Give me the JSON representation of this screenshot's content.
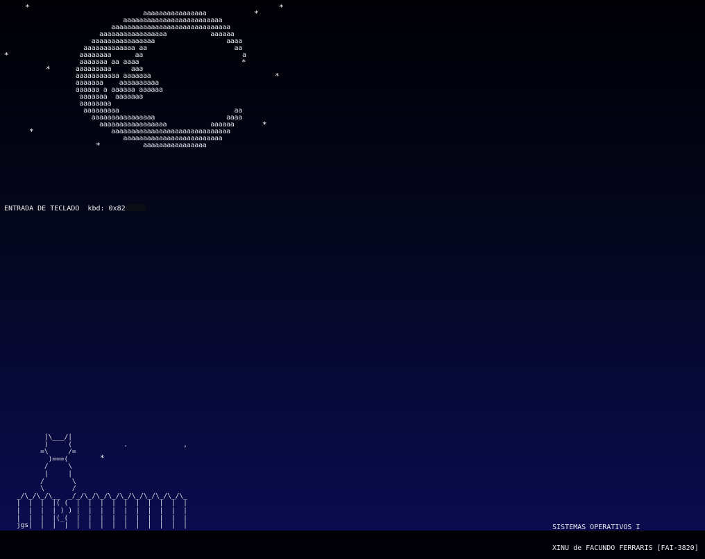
{
  "stars": [
    "*",
    "*",
    "*",
    "*",
    "*",
    "*",
    "*",
    "*",
    "*",
    "*",
    "*"
  ],
  "moon_art": "                                    aaaaaaaaaaaaaaaa\n                               aaaaaaaaaaaaaaaaaaaaaaaaa\n                            aaaaaaaaaaaaaaaaaaaaaaaaaaaaaa\n                         aaaaaaaaaaaaaaaaa           aaaaaa\n                       aaaaaaaaaaaaaaaa                  aaaa\n                     aaaaaaaaaaaaa aa                      aa\n                    aaaaaaaa      aa                         a\n                    aaaaaaa aa aaaa\n                   aaaaaaaaa     aaa\n                   aaaaaaaaaaa aaaaaaa\n                   aaaaaaa    aaaaaaaaaa\n                   aaaaaa a aaaaaa aaaaaa\n                    aaaaaaa  aaaaaaa\n                    aaaaaaaa\n                     aaaaaaaaa                             aa\n                       aaaaaaaaaaaaaaaa                  aaaa\n                         aaaaaaaaaaaaaaaaa           aaaaaa\n                            aaaaaaaaaaaaaaaaaaaaaaaaaaaaaa\n                               aaaaaaaaaaaaaaaaaaaaaaaaa\n                                    aaaaaaaaaaaaaaaa",
  "keyboard": {
    "label": "ENTRADA DE TECLADO",
    "value": "kbd: 0x82"
  },
  "cat_art": "        |\\___/|\n        )     (             .              ,\n       =\\     /=\n         )===(\n        /     \\\n        |     |\n       /       \\\n       \\       /\n _/\\_/\\_/\\__  _/_/\\_/\\_/\\_/\\_/\\_/\\_/\\_/\\_/\\_\n |  |  |  |( (  |  |  |  |  |  |  |  |  |  |\n |  |  |  | ) ) |  |  |  |  |  |  |  |  |  |\n |  |  |  |(_(  |  |  |  |  |  |  |  |  |  |\n jgs|  |  |  |  |  |  |  |  |  |  |  |  |  |",
  "credits": {
    "line1": "SISTEMAS OPERATIVOS I",
    "line2": "XINU de FACUNDO FERRARIS [FAI-3820]"
  }
}
